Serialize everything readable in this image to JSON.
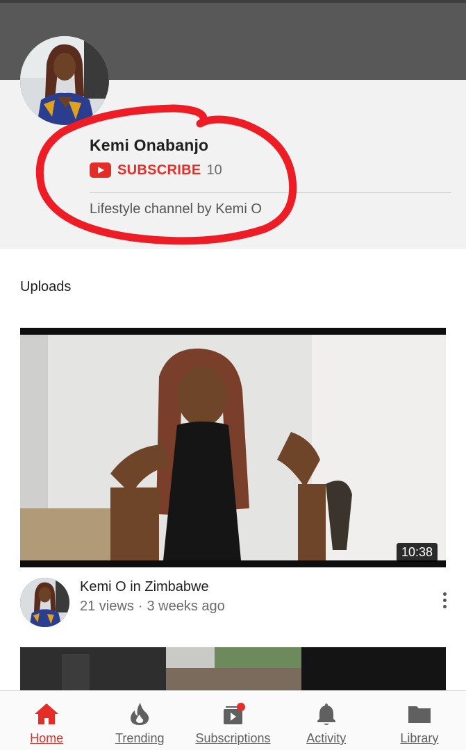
{
  "channel": {
    "name": "Kemi Onabanjo",
    "subscribe_label": "SUBSCRIBE",
    "subscriber_count": "10",
    "description": "Lifestyle channel by Kemi O"
  },
  "uploads": {
    "section_title": "Uploads",
    "videos": [
      {
        "title": "Kemi O in Zimbabwe",
        "views": "21 views",
        "separator": "·",
        "age": "3 weeks ago",
        "duration": "10:38"
      }
    ]
  },
  "bottom_nav": {
    "items": [
      {
        "label": "Home",
        "icon": "home-icon",
        "active": true
      },
      {
        "label": "Trending",
        "icon": "flame-icon",
        "active": false
      },
      {
        "label": "Subscriptions",
        "icon": "subscriptions-icon",
        "active": false
      },
      {
        "label": "Activity",
        "icon": "bell-icon",
        "active": false
      },
      {
        "label": "Library",
        "icon": "folder-icon",
        "active": false
      }
    ]
  },
  "colors": {
    "accent": "#e52d27",
    "banner": "#585858",
    "header_bg": "#f2f2f2",
    "annotation_circle": "#ee1c24"
  }
}
